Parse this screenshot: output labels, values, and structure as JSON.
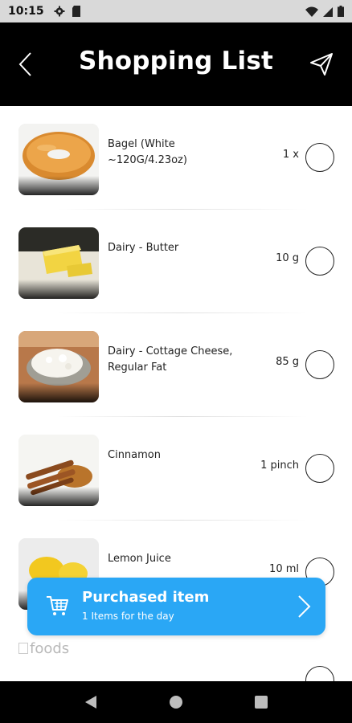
{
  "status_bar": {
    "time": "10:15"
  },
  "header": {
    "title": "Shopping List"
  },
  "items": [
    {
      "name": "Bagel (White ~120G/4.23oz)",
      "qty": "1 x"
    },
    {
      "name": "Dairy - Butter",
      "qty": "10 g"
    },
    {
      "name": "Dairy - Cottage Cheese, Regular Fat",
      "qty": "85 g"
    },
    {
      "name": "Cinnamon",
      "qty": "1 pinch"
    },
    {
      "name": "Lemon Juice",
      "qty": "10 ml"
    }
  ],
  "partial_item": {
    "image_alt": "foods"
  },
  "purchased": {
    "title": "Purchased item",
    "subtitle": "1 Items for the day"
  },
  "colors": {
    "header_bg": "#000000",
    "banner_bg": "#2aa7f5",
    "status_bg": "#d9d9d9"
  }
}
